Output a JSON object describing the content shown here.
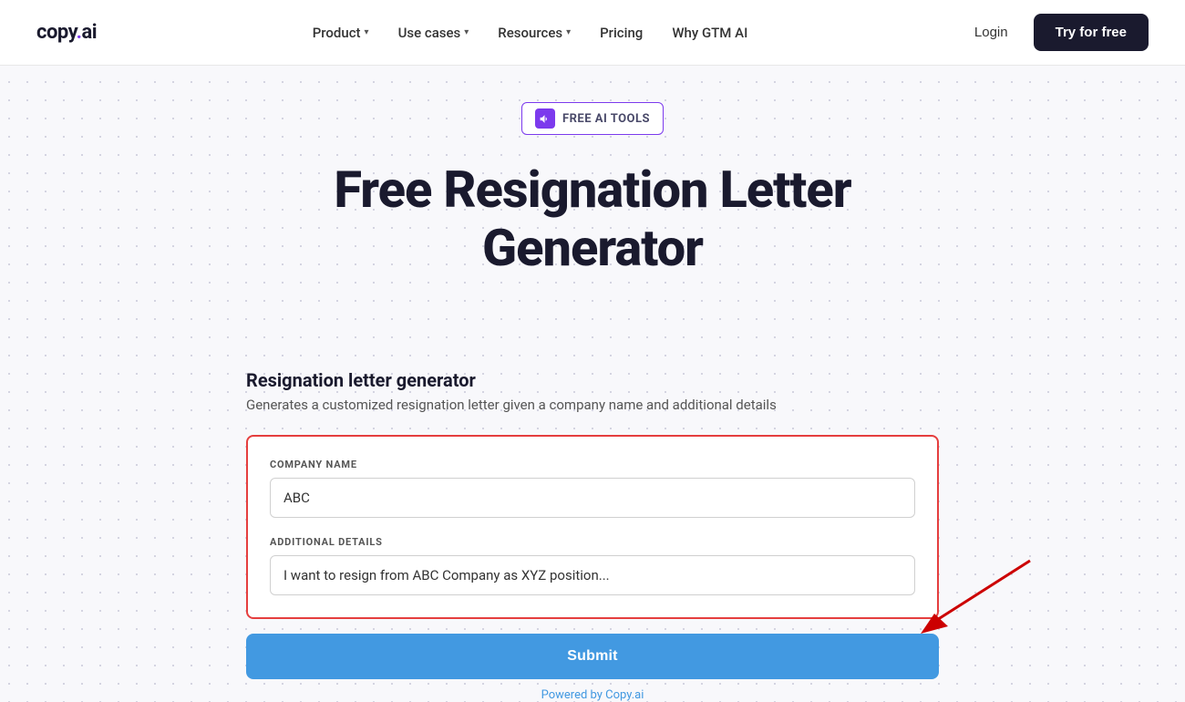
{
  "logo": {
    "text": "copy.ai",
    "dot_color": "#7c3aed"
  },
  "nav": {
    "items": [
      {
        "label": "Product",
        "has_dropdown": true
      },
      {
        "label": "Use cases",
        "has_dropdown": true
      },
      {
        "label": "Resources",
        "has_dropdown": true
      },
      {
        "label": "Pricing",
        "has_dropdown": false
      },
      {
        "label": "Why GTM AI",
        "has_dropdown": false
      }
    ],
    "login_label": "Login",
    "try_label": "Try for free"
  },
  "badge": {
    "label": "FREE AI TOOLS"
  },
  "hero": {
    "headline_line1": "Free Resignation Letter",
    "headline_line2": "Generator"
  },
  "form_section": {
    "title": "Resignation letter generator",
    "description": "Generates a customized resignation letter given a company name and additional details"
  },
  "form": {
    "company_name_label": "COMPANY NAME",
    "company_name_value": "ABC",
    "company_name_placeholder": "",
    "additional_details_label": "ADDITIONAL DETAILS",
    "additional_details_value": "I want to resign from ABC Company as XYZ position...",
    "additional_details_placeholder": "I want to resign from ABC Company as XYZ position...",
    "submit_label": "Submit"
  },
  "footer": {
    "powered_by": "Powered by Copy.ai"
  }
}
